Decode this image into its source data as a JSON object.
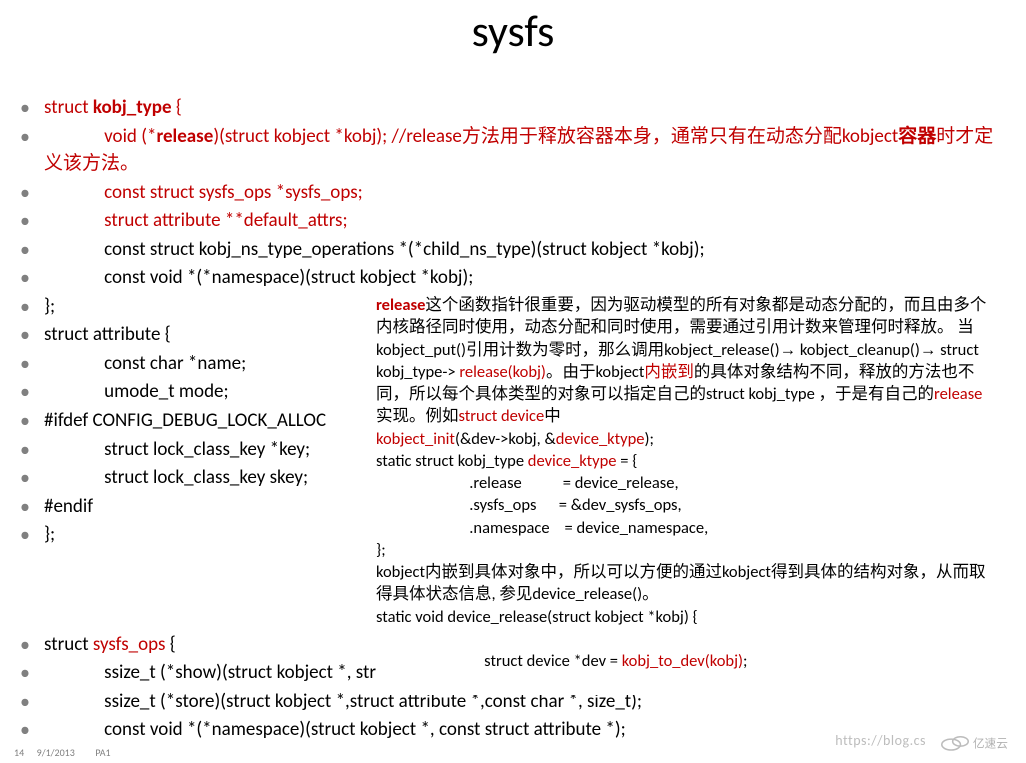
{
  "title": "sysfs",
  "bullets": {
    "b1_pre": "struct ",
    "b1_mid": "kobj_type",
    "b1_post": " {",
    "b2_i": "              ",
    "b2_a": "void (*",
    "b2_b": "release",
    "b2_c": ")(struct kobject *kobj); //release方法用于释放容器本身，通常只有在动态分配kobject",
    "b2_d": "容器",
    "b2_e": "时才定义该方法。",
    "b3_i": "              ",
    "b3": "const struct sysfs_ops *sysfs_ops;",
    "b4_i": "              ",
    "b4": "struct attribute **default_attrs;",
    "b5_i": "              ",
    "b5": "const struct kobj_ns_type_operations *(*child_ns_type)(struct kobject *kobj);",
    "b6_i": "              ",
    "b6": "const void *(*namespace)(struct kobject *kobj);",
    "b7": "};",
    "b8": "struct attribute {",
    "b9_i": "              ",
    "b9": "const char     *name;",
    "b10_i": "              ",
    "b10": "umode_t      mode;",
    "b11": "#ifdef CONFIG_DEBUG_LOCK_ALLOC",
    "b12_i": "              ",
    "b12": "struct lock_class_key        *key;",
    "b13_i": "              ",
    "b13": "struct lock_class_key        skey;",
    "b14": "#endif",
    "b15": "};",
    "b16_a": "struct ",
    "b16_b": "sysfs_ops",
    "b16_c": " {",
    "b17_i": "              ",
    "b17": "ssize_t            (*show)(struct kobject *, struct attribute *,char *);",
    "b18_i": "              ",
    "b18": "ssize_t            (*store)(struct kobject *,struct attribute *,const char *, size_t);",
    "b19_i": "              ",
    "b19": "const void *(*namespace)(struct kobject *, const struct attribute *);",
    "b20": "};"
  },
  "rbox": {
    "l1a": "release",
    "l1b": "这个函数指针很重要，因为驱动模型的所有对象都是动态分配的，而且由多个内核路径同时使用，动态分配和同时使用，需要通过引用计数来管理何时释放。 当kobject_put()引用计数为零时，那么调用kobject_release()",
    "l1arrow": "→",
    "l1c": "kobject_cleanup()",
    "l1arrow2": "→",
    "l1d": "  struct kobj_type-> ",
    "l1e": "release(kobj)",
    "l1f": "。由于kobject",
    "l1g": "内嵌到",
    "l1h": "的具体对象结构不同，释放的方法也不同，所以每个具体类型的对象可以指定自己的struct kobj_type ，于是有自己的",
    "l1i": "release",
    "l1j": "实现。例如",
    "l1k": "struct  device",
    "l1l": "中",
    "l2a": "kobject_init",
    "l2b": "(&dev->kobj,  &",
    "l2c": "device_ktype",
    "l2d": ");",
    "l3a": "static struct  kobj_type  ",
    "l3b": "device_ktype ",
    "l3c": " = {",
    "l4": "                         .release           = device_release,",
    "l5": "                         .sysfs_ops      = &dev_sysfs_ops,",
    "l6": "                         .namespace    = device_namespace,",
    "l7": "};",
    "l8": "kobject内嵌到具体对象中，所以可以方便的通过kobject得到具体的结构对象，从而取得具体状态信息,  参见device_release()。",
    "l9": "static void device_release(struct  kobject *kobj) {",
    "l10a": "                         struct device *dev = ",
    "l10b": "kobj_to_dev(kobj)",
    "l10c": ";"
  },
  "footer": {
    "slidenum": "14",
    "date": "9/1/2013",
    "tag": "PA1"
  },
  "watermark": {
    "url": "https://blog.cs",
    "brand": "亿速云"
  }
}
